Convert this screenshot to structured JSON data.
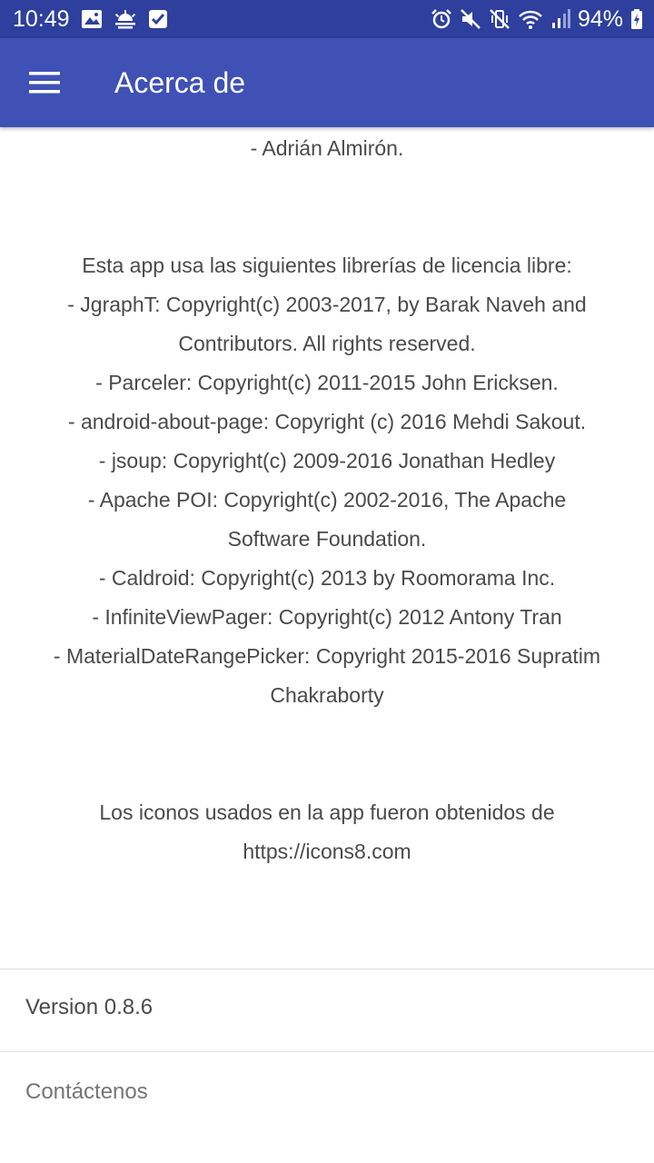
{
  "status_bar": {
    "time": "10:49",
    "battery": "94%",
    "left_icons": [
      "image-icon",
      "weather-icon",
      "checkbox-icon"
    ],
    "right_icons": [
      "alarm-icon",
      "mute-icon",
      "vibrate-icon",
      "wifi-icon",
      "signal-icon",
      "battery-charging-icon"
    ]
  },
  "app_bar": {
    "title": "Acerca de",
    "menu_icon": "hamburger-menu-icon"
  },
  "content": {
    "author_line": "- Adrián Almirón.",
    "libraries_intro": "Esta app usa las siguientes librerías de licencia libre:",
    "libraries": [
      "- JgraphT: Copyright(c) 2003-2017, by Barak Naveh and Contributors. All rights reserved.",
      "- Parceler: Copyright(c) 2011-2015 John Ericksen.",
      "- android-about-page: Copyright (c) 2016 Mehdi Sakout.",
      "- jsoup: Copyright(c) 2009-2016 Jonathan Hedley",
      "- Apache POI: Copyright(c) 2002-2016, The Apache Software Foundation.",
      "- Caldroid: Copyright(c) 2013 by Roomorama Inc.",
      "- InfiniteViewPager: Copyright(c) 2012 Antony Tran",
      "- MaterialDateRangePicker: Copyright 2015-2016 Supratim Chakraborty"
    ],
    "icons_credit": "Los iconos usados en la app fueron obtenidos de https://icons8.com"
  },
  "footer": {
    "version": "Version 0.8.6",
    "contact": "Contáctenos"
  },
  "colors": {
    "status_bar": "#2e3f9e",
    "app_bar": "#3f51b5",
    "body_text": "#4a4a4a",
    "contact_text": "#757575"
  }
}
